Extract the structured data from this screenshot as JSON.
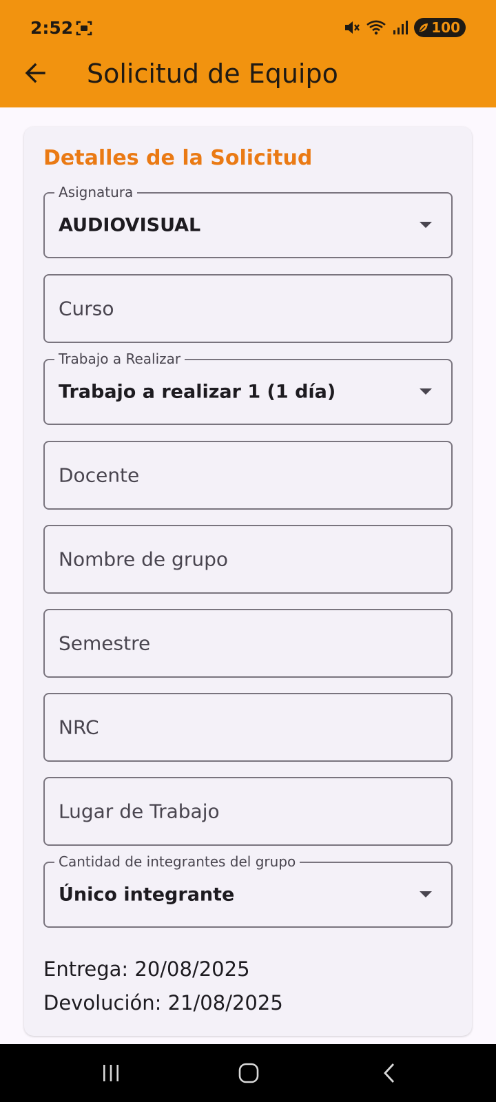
{
  "status_bar": {
    "time": "2:52",
    "battery": "100",
    "icons": [
      "screenshot-icon",
      "mute-icon",
      "wifi-icon",
      "signal-icon",
      "battery-icon"
    ]
  },
  "app_bar": {
    "title": "Solicitud de Equipo",
    "back_icon": "back-arrow-icon",
    "background": "#f2930f"
  },
  "card": {
    "section_title": "Detalles de la Solicitud",
    "accent_color": "#ea7a14"
  },
  "fields": {
    "asignatura": {
      "label": "Asignatura",
      "value": "AUDIOVISUAL"
    },
    "curso": {
      "placeholder": "Curso"
    },
    "trabajo": {
      "label": "Trabajo a Realizar",
      "value": "Trabajo a realizar 1 (1 día)"
    },
    "docente": {
      "placeholder": "Docente"
    },
    "grupo": {
      "placeholder": "Nombre de grupo"
    },
    "semestre": {
      "placeholder": "Semestre"
    },
    "nrc": {
      "placeholder": "NRC"
    },
    "lugar": {
      "placeholder": "Lugar de Trabajo"
    },
    "integrantes": {
      "label": "Cantidad de integrantes del grupo",
      "value": "Único integrante"
    }
  },
  "dates": {
    "entrega": "Entrega: 20/08/2025",
    "devolucion": "Devolución: 21/08/2025"
  },
  "nav_bar": {
    "buttons": [
      "recents-icon",
      "home-icon",
      "back-icon"
    ]
  }
}
